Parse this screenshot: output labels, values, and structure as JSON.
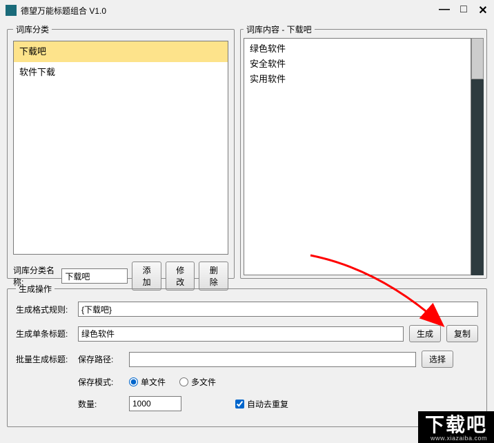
{
  "window": {
    "title": "德望万能标题组合  V1.0"
  },
  "leftPanel": {
    "legend": "词库分类",
    "items": [
      {
        "name": "下载吧",
        "selected": true
      },
      {
        "name": "软件下载",
        "selected": false
      }
    ],
    "nameLabel": "词库分类名称:",
    "nameValue": "下载吧",
    "addBtn": "添加",
    "editBtn": "修改",
    "deleteBtn": "删除"
  },
  "rightPanel": {
    "legend": "词库内容 - 下载吧",
    "items": [
      "绿色软件",
      "安全软件",
      "实用软件"
    ]
  },
  "genPanel": {
    "legend": "生成操作",
    "ruleLabel": "生成格式规则:",
    "ruleValue": "{下载吧}",
    "singleLabel": "生成单条标题:",
    "singleValue": "绿色软件",
    "genBtn": "生成",
    "copyBtn": "复制",
    "batchLabel": "批量生成标题:",
    "savePathLabel": "保存路径:",
    "savePathValue": "",
    "selectBtn": "选择",
    "saveModeLabel": "保存模式:",
    "singleFileLabel": "单文件",
    "multiFileLabel": "多文件",
    "countLabel": "数量:",
    "countValue": "1000",
    "dedupLabel": "自动去重复"
  },
  "watermark": {
    "big": "下载吧",
    "url": "www.xiazaiba.com"
  }
}
